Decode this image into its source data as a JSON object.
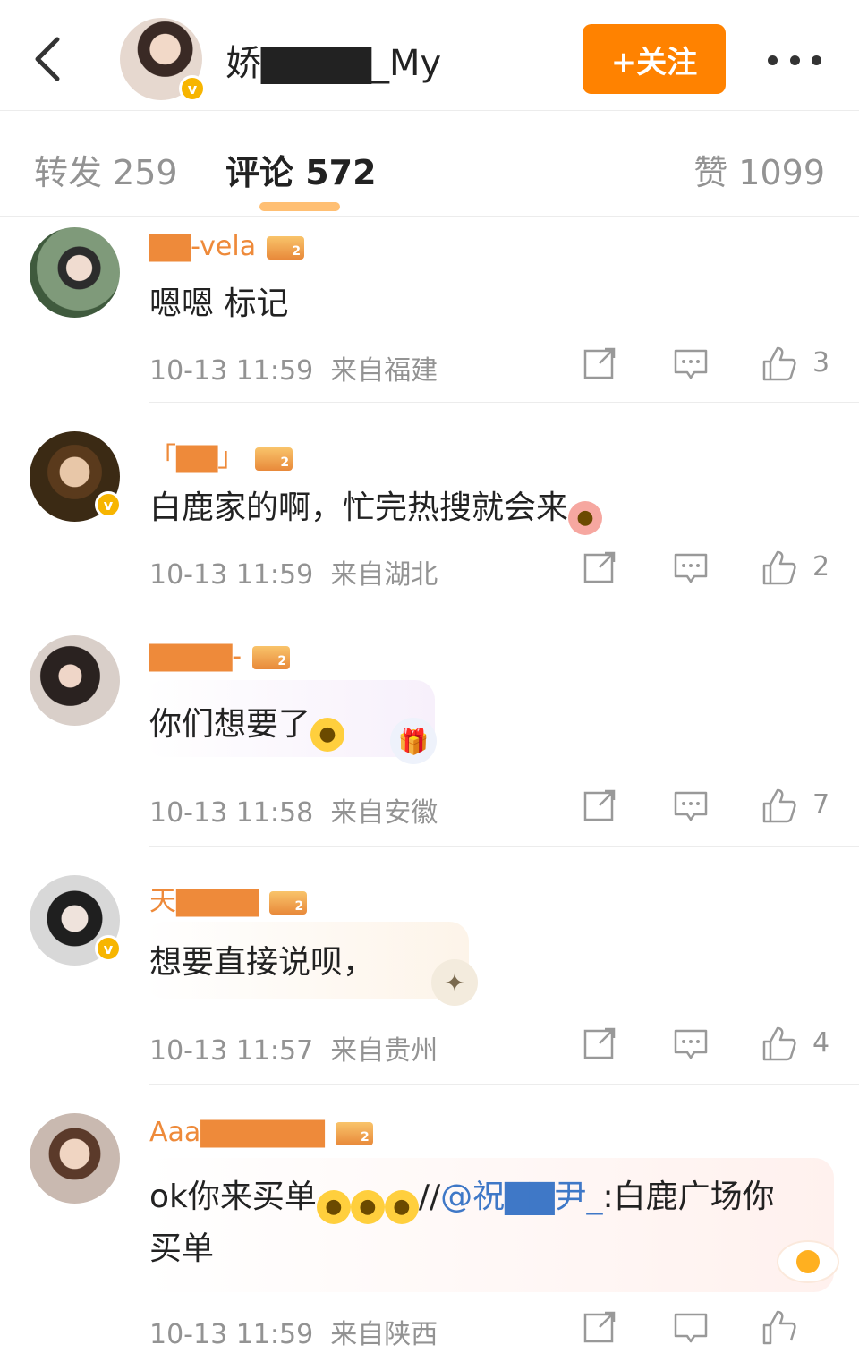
{
  "header": {
    "author_name": "娇▇▇▇▇_My",
    "follow_label": "+关注",
    "verified_badge": "v"
  },
  "tabs": {
    "reposts": "转发 259",
    "comments": "评论 572",
    "likes": "赞 1099"
  },
  "comments": [
    {
      "name": "▇▇-vela",
      "text": "嗯嗯 标记",
      "time": "10-13 11:59",
      "location": "来自福建",
      "likes": "3"
    },
    {
      "name": "「▇▇」",
      "text": "白鹿家的啊，忙完热搜就会来",
      "time": "10-13 11:59",
      "location": "来自湖北",
      "likes": "2"
    },
    {
      "name": "▇▇▇▇-",
      "text": "你们想要了",
      "time": "10-13 11:58",
      "location": "来自安徽",
      "likes": "7"
    },
    {
      "name": "天▇▇▇▇",
      "text": "想要直接说呗，",
      "time": "10-13 11:57",
      "location": "来自贵州",
      "likes": "4"
    },
    {
      "name": "Aaa▇▇▇▇▇▇",
      "text_prefix": "ok你来买单",
      "text_sep": "//",
      "mention": "@祝▇▇尹_",
      "text_suffix": ":白鹿广场你",
      "text_line2": "买单",
      "time": "10-13 11:59",
      "location": "来自陕西"
    }
  ],
  "colors": {
    "accent": "#ff8200",
    "username": "#ee8a3a",
    "mention": "#3f78c7",
    "meta": "#939393"
  },
  "icons": [
    "back-arrow-icon",
    "more-dots-icon",
    "verified-badge-icon",
    "crown-level-icon",
    "share-icon",
    "reply-icon",
    "like-icon"
  ]
}
